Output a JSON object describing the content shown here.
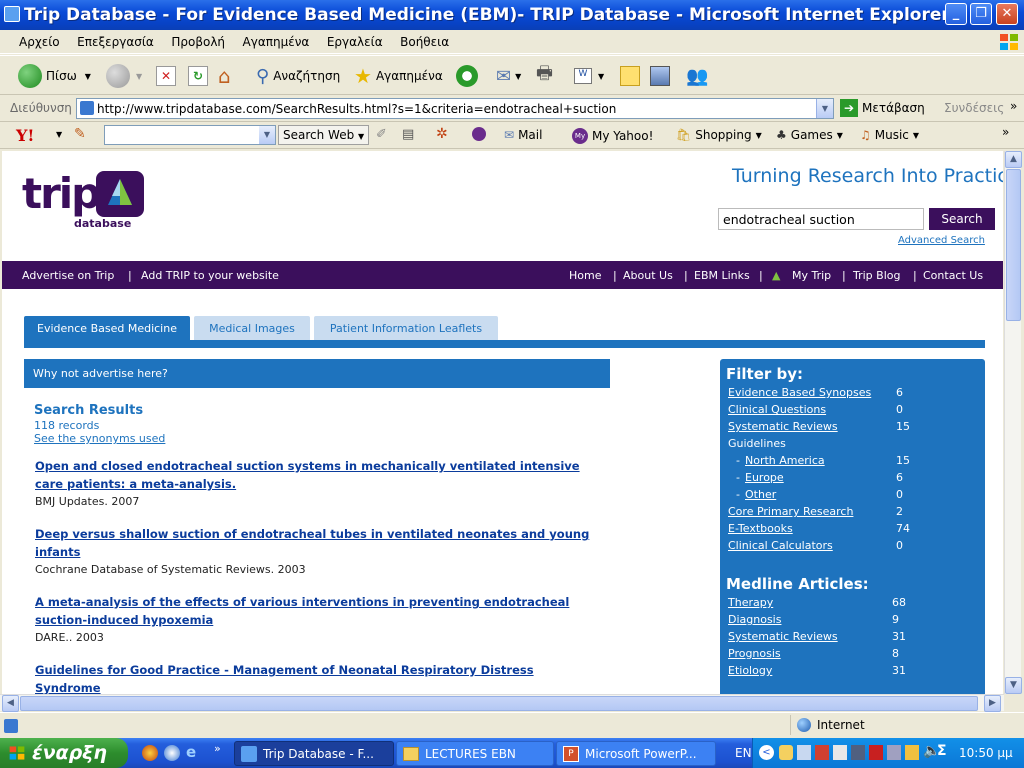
{
  "window": {
    "title": "Trip Database - For Evidence Based Medicine (EBM)- TRIP Database - Microsoft Internet Explorer",
    "min": "_",
    "max": "❐",
    "close": "✕"
  },
  "menu": [
    "Αρχείο",
    "Επεξεργασία",
    "Προβολή",
    "Αγαπημένα",
    "Εργαλεία",
    "Βοήθεια"
  ],
  "toolbar": {
    "back": "Πίσω",
    "search": "Αναζήτηση",
    "favorites": "Αγαπημένα"
  },
  "address": {
    "label": "Διεύθυνση",
    "url": "http://www.tripdatabase.com/SearchResults.html?s=1&criteria=endotracheal+suction",
    "go": "Μετάβαση",
    "links": "Συνδέσεις"
  },
  "yahoo": {
    "logo": "Y!",
    "search_web": "Search Web",
    "mail": "Mail",
    "my_yahoo": "My Yahoo!",
    "shopping": "Shopping",
    "games": "Games",
    "music": "Music"
  },
  "site": {
    "logo_text": "trip",
    "logo_sub": "database",
    "tagline": "Turning Research Into Practice",
    "search_value": "endotracheal suction",
    "search_button": "Search",
    "advanced_search": "Advanced Search",
    "nav_left": [
      "Advertise on Trip",
      "Add TRIP to your website"
    ],
    "nav_right": [
      "Home",
      "About Us",
      "EBM Links",
      "My Trip",
      "Trip Blog",
      "Contact Us"
    ],
    "tabs": [
      "Evidence Based Medicine",
      "Medical Images",
      "Patient Information Leaflets"
    ],
    "advert": "Why not advertise here?",
    "results_heading": "Search Results",
    "records": "118 records",
    "synonyms": "See the synonyms used",
    "results": [
      {
        "title_l1": "Open and closed endotracheal suction systems in mechanically ventilated intensive",
        "title_l2": "care patients: a meta-analysis.",
        "source": "BMJ Updates. 2007"
      },
      {
        "title_l1": "Deep versus shallow suction of endotracheal tubes in ventilated neonates and young",
        "title_l2": "infants",
        "source": "Cochrane Database of Systematic Reviews. 2003"
      },
      {
        "title_l1": "A meta-analysis of the effects of various interventions in preventing endotracheal",
        "title_l2": "suction-induced hypoxemia",
        "source": "DARE.. 2003"
      },
      {
        "title_l1": "Guidelines for Good Practice - Management of Neonatal Respiratory Distress",
        "title_l2": "Syndrome",
        "source": ""
      }
    ],
    "filter_heading": "Filter by:",
    "filters": [
      {
        "name": "Evidence Based Synopses",
        "count": "6"
      },
      {
        "name": "Clinical Questions",
        "count": "0"
      },
      {
        "name": "Systematic Reviews",
        "count": "15"
      },
      {
        "name": "Guidelines",
        "count": ""
      },
      {
        "name": "North America",
        "count": "15"
      },
      {
        "name": "Europe",
        "count": "6"
      },
      {
        "name": "Other",
        "count": "0"
      },
      {
        "name": "Core Primary Research",
        "count": "2"
      },
      {
        "name": "E-Textbooks",
        "count": "74"
      },
      {
        "name": "Clinical Calculators",
        "count": "0"
      }
    ],
    "medline_heading": "Medline Articles:",
    "medline": [
      {
        "name": "Therapy",
        "count": "68"
      },
      {
        "name": "Diagnosis",
        "count": "9"
      },
      {
        "name": "Systematic Reviews",
        "count": "31"
      },
      {
        "name": "Prognosis",
        "count": "8"
      },
      {
        "name": "Etiology",
        "count": "31"
      }
    ]
  },
  "status": {
    "zone": "Internet"
  },
  "taskbar": {
    "start": "έναρξη",
    "tasks": [
      "Trip Database - F...",
      "LECTURES EBN",
      "Microsoft PowerP..."
    ],
    "lang": "EN",
    "clock": "10:50 μμ"
  },
  "colors": {
    "trip_purple": "#3B0F5C",
    "trip_blue": "#1E73BE",
    "link": "#0B3C9C"
  }
}
